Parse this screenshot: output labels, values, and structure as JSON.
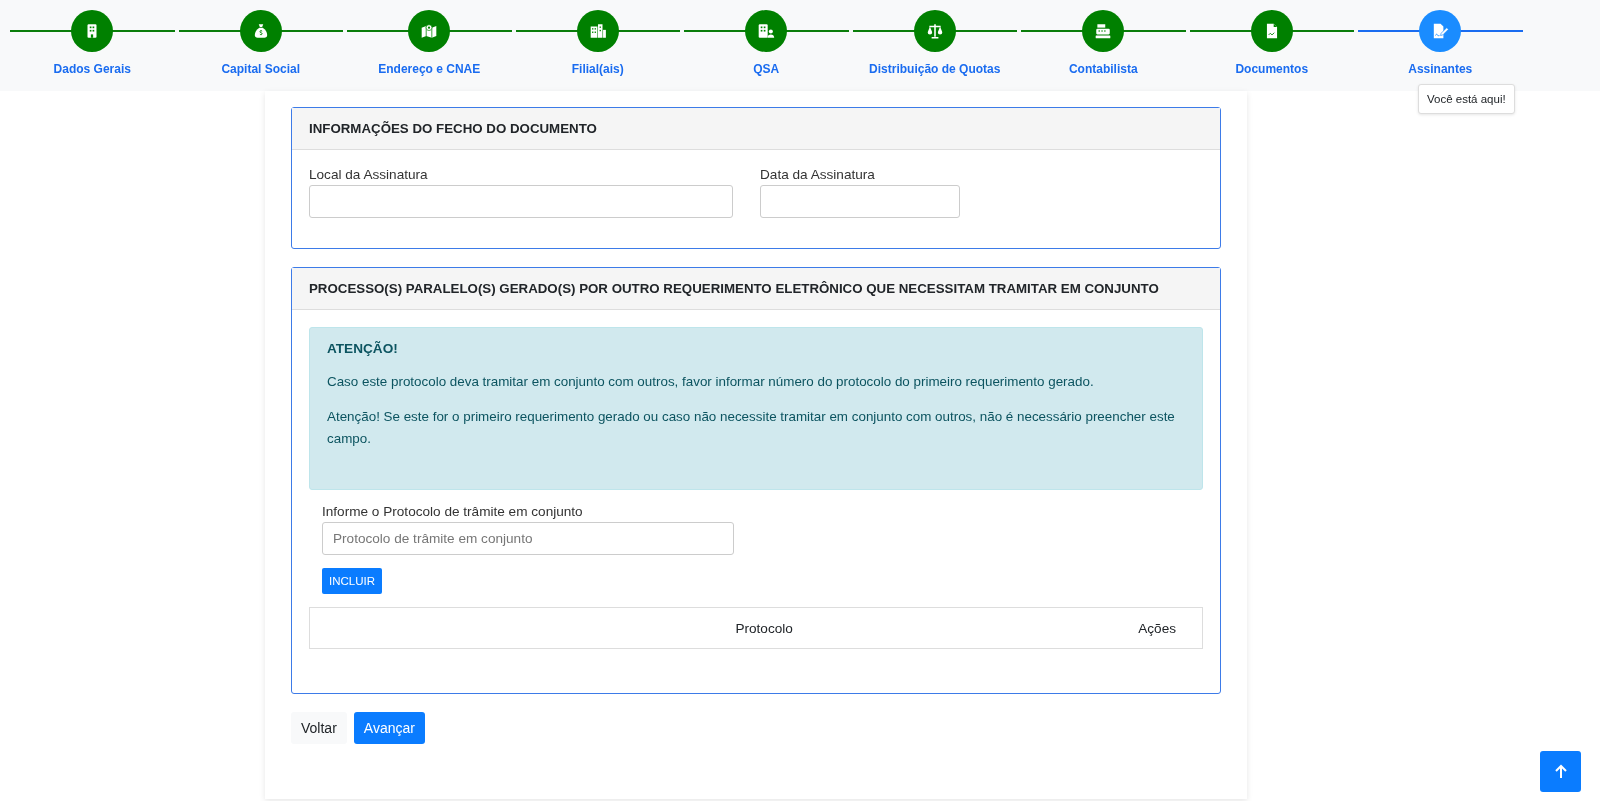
{
  "steps": [
    {
      "label": "Dados Gerais",
      "selected": false
    },
    {
      "label": "Capital Social",
      "selected": false
    },
    {
      "label": "Endereço e CNAE",
      "selected": false
    },
    {
      "label": "Filial(ais)",
      "selected": false
    },
    {
      "label": "QSA",
      "selected": false
    },
    {
      "label": "Distribuição de Quotas",
      "selected": false
    },
    {
      "label": "Contabilista",
      "selected": false
    },
    {
      "label": "Documentos",
      "selected": false
    },
    {
      "label": "Assinantes",
      "selected": true
    }
  ],
  "tooltip": "Você está aqui!",
  "panels": [
    {
      "kind": "fields",
      "title": "INFORMAÇÕES DO FECHO DO DOCUMENTO",
      "fields": [
        {
          "label": "Local da Assinatura"
        },
        {
          "label": "Data da Assinatura"
        }
      ]
    },
    {
      "kind": "parallel",
      "title": "PROCESSO(S) PARALELO(S) GERADO(S) POR OUTRO REQUERIMENTO ELETRÔNICO QUE NECESSITAM TRAMITAR EM CONJUNTO",
      "alert": {
        "title": "ATENÇÃO!",
        "paragraphs": [
          "Caso este protocolo deva tramitar em conjunto com outros, favor informar número do protocolo do primeiro requerimento gerado.",
          "Atenção! Se este for o primeiro requerimento gerado ou caso não necessite tramitar em conjunto com outros, não é necessário preencher este campo."
        ]
      },
      "field": {
        "label": "Informe o Protocolo de trâmite em conjunto",
        "placeholder": "Protocolo de trâmite em conjunto"
      },
      "add_button": "INCLUIR",
      "table": {
        "columns": [
          "Protocolo",
          "Ações"
        ]
      }
    }
  ],
  "buttons": [
    {
      "label": "Voltar",
      "kind": "secondary"
    },
    {
      "label": "Avançar",
      "kind": "primary"
    }
  ]
}
